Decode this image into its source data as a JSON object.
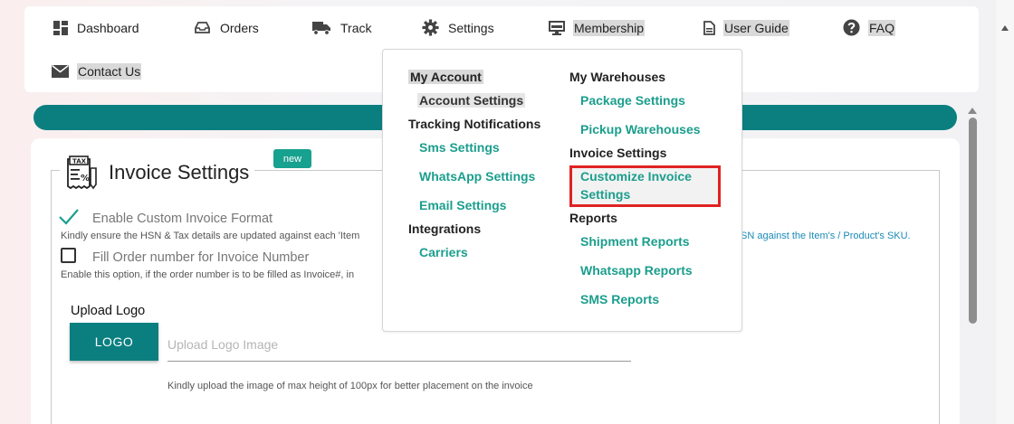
{
  "nav": {
    "dashboard": "Dashboard",
    "orders": "Orders",
    "track": "Track",
    "settings": "Settings",
    "membership": "Membership",
    "user_guide": "User Guide",
    "faq": "FAQ",
    "contact_us": "Contact Us"
  },
  "dropdown": {
    "my_account": "My Account",
    "account_settings": "Account Settings",
    "tracking_notifications": "Tracking Notifications",
    "sms_settings": "Sms Settings",
    "whatsapp_settings": "WhatsApp Settings",
    "email_settings": "Email Settings",
    "integrations": "Integrations",
    "carriers": "Carriers",
    "my_warehouses": "My Warehouses",
    "package_settings": "Package Settings",
    "pickup_warehouses": "Pickup Warehouses",
    "invoice_settings_head": "Invoice Settings",
    "customize_invoice_settings": "Customize Invoice Settings",
    "reports": "Reports",
    "shipment_reports": "Shipment Reports",
    "whatsapp_reports": "Whatsapp Reports",
    "sms_reports": "SMS Reports"
  },
  "invoice": {
    "title": "Invoice Settings",
    "badge": "new",
    "enable_custom_label": "Enable Custom Invoice Format",
    "enable_custom_help": "Kindly ensure the HSN & Tax details are updated against each 'Item",
    "enable_custom_help_right": "SN against the Item's / Product's SKU.",
    "fill_order_label": "Fill Order number for Invoice Number",
    "fill_order_help": "Enable this option, if the order number is to be filled as Invoice#, in",
    "upload_logo_label": "Upload Logo",
    "logo_button": "LOGO",
    "logo_placeholder": "Upload Logo Image",
    "logo_help": "Kindly upload the image of max height of 100px for better placement on the invoice"
  },
  "colors": {
    "teal": "#0b7f80",
    "link": "#1b9e8d",
    "highlight_red": "#e02222"
  }
}
